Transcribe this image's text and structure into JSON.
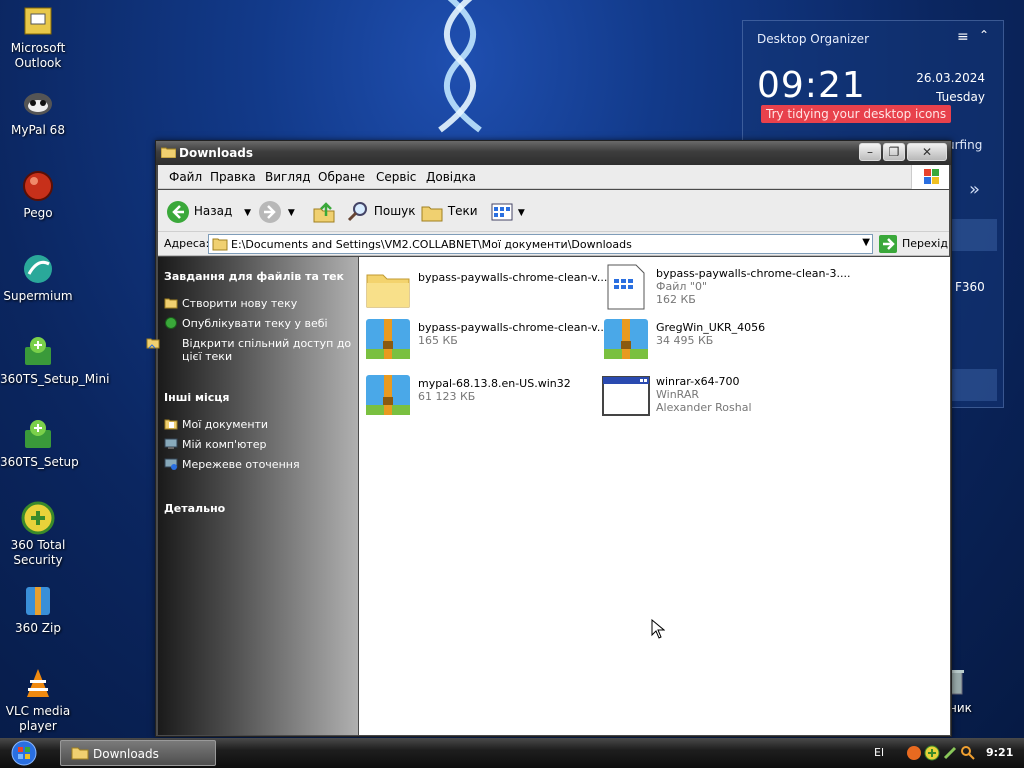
{
  "desktop": {
    "icons": [
      {
        "label": "Microsoft Outlook"
      },
      {
        "label": "MyPal 68"
      },
      {
        "label": "Pego"
      },
      {
        "label": "Supermium"
      },
      {
        "label": "360TS_Setup_Mini"
      },
      {
        "label": "360TS_Setup"
      },
      {
        "label": "360 Total Security"
      },
      {
        "label": "360 Zip"
      },
      {
        "label": "VLC media player"
      }
    ],
    "trash_label": "ник"
  },
  "organizer": {
    "title": "Desktop Organizer",
    "time": "09:21",
    "date": "26.03.2024",
    "day": "Tuesday",
    "tip": "Try tidying your desktop icons",
    "partial_surfing": "urfing",
    "partial_360": "F360",
    "chevron": "»"
  },
  "window": {
    "title": "Downloads",
    "menu": [
      "Файл",
      "Правка",
      "Вигляд",
      "Обране",
      "Сервіс",
      "Довідка"
    ],
    "toolbar": {
      "back": "Назад",
      "search": "Пошук",
      "folders": "Теки"
    },
    "address": {
      "label": "Адреса:",
      "path": "E:\\Documents and Settings\\VM2.COLLABNET\\Мої документи\\Downloads",
      "go": "Перехід"
    },
    "sidebar": {
      "tasks_title": "Завдання для файлів та тек",
      "tasks": [
        "Створити нову теку",
        "Опублікувати теку у вебі",
        "Відкрити спільний доступ до цієї теки"
      ],
      "places_title": "Інші місця",
      "places": [
        "Мої документи",
        "Мій комп'ютер",
        "Мережеве оточення"
      ],
      "details_title": "Детально"
    },
    "files": [
      {
        "name": "bypass-paywalls-chrome-clean-v...",
        "size": "",
        "extra": "",
        "icon": "folder-icon"
      },
      {
        "name": "bypass-paywalls-chrome-clean-3....",
        "size": "Файл \"0\"",
        "extra": "162 КБ",
        "icon": "file-icon"
      },
      {
        "name": "bypass-paywalls-chrome-clean-v...",
        "size": "165 КБ",
        "extra": "",
        "icon": "zip-archive-icon"
      },
      {
        "name": "GregWin_UKR_4056",
        "size": "34 495 КБ",
        "extra": "",
        "icon": "zip-archive-icon"
      },
      {
        "name": "mypal-68.13.8.en-US.win32",
        "size": "61 123 КБ",
        "extra": "",
        "icon": "zip-archive-icon"
      },
      {
        "name": "winrar-x64-700",
        "size": "WinRAR",
        "extra": "Alexander Roshal",
        "icon": "application-icon"
      }
    ]
  },
  "taskbar": {
    "task_label": "Downloads",
    "lang": "El",
    "clock": "9:21"
  }
}
